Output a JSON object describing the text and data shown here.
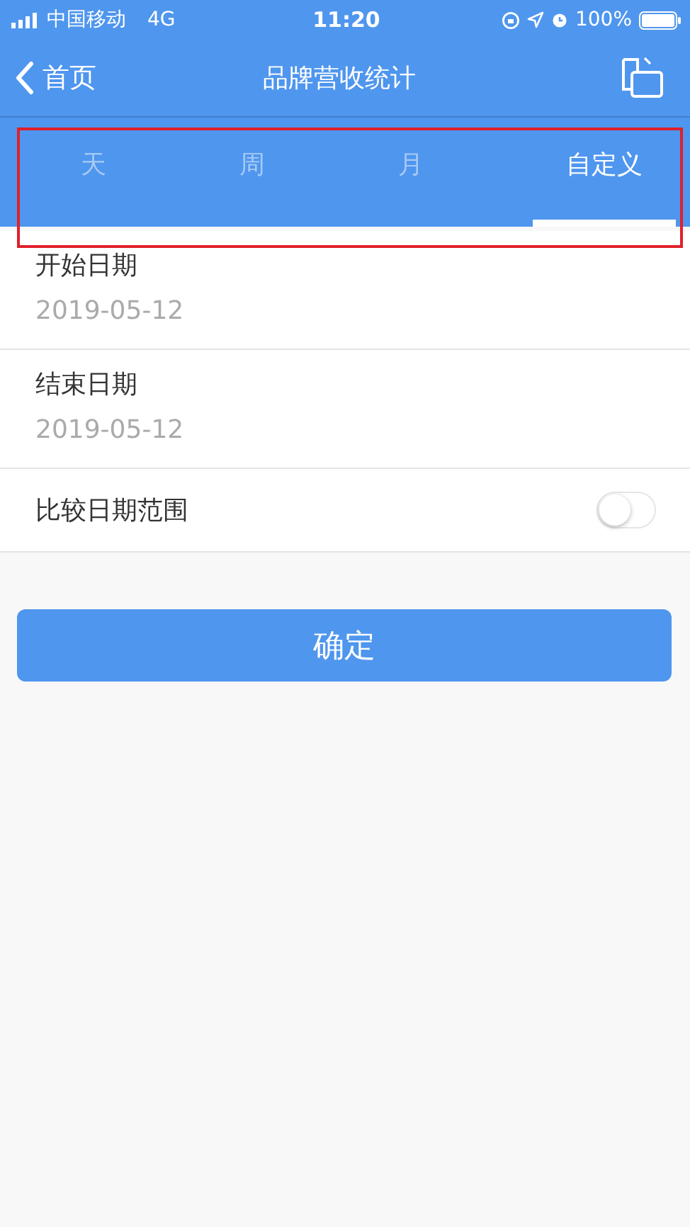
{
  "status_bar": {
    "carrier": "中国移动",
    "network": "4G",
    "time": "11:20",
    "battery": "100%"
  },
  "nav": {
    "back": "首页",
    "title": "品牌营收统计"
  },
  "tabs": [
    {
      "label": "天",
      "selected": false
    },
    {
      "label": "周",
      "selected": false
    },
    {
      "label": "月",
      "selected": false
    },
    {
      "label": "自定义",
      "selected": true
    }
  ],
  "fields": [
    {
      "label": "开始日期",
      "value": "2019-05-12"
    },
    {
      "label": "结束日期",
      "value": "2019-05-12"
    }
  ],
  "compare": {
    "label": "比较日期范围",
    "on": false
  },
  "confirm": "确定"
}
